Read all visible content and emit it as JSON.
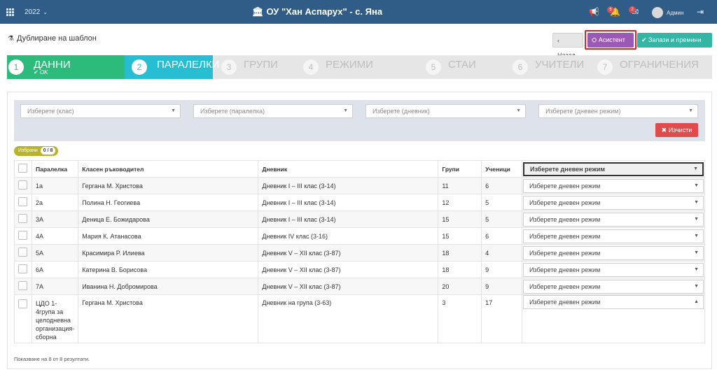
{
  "topbar": {
    "year": "2022",
    "school": "ОУ \"Хан Аспарух\" - с. Яна",
    "badge_notifications": "6",
    "badge_messages": "2",
    "user": "Админ"
  },
  "header": {
    "title": "Дублиране на шаблон",
    "back_label": "Назад",
    "assistant_label": "Асистент",
    "save_label": "Запази и премини"
  },
  "steps": [
    {
      "num": "1",
      "label": "ДАННИ",
      "sub": "OK"
    },
    {
      "num": "2",
      "label": "ПАРАЛЕЛКИ"
    },
    {
      "num": "3",
      "label": "ГРУПИ"
    },
    {
      "num": "4",
      "label": "РЕЖИМИ"
    },
    {
      "num": "5",
      "label": "СТАИ"
    },
    {
      "num": "6",
      "label": "УЧИТЕЛИ"
    },
    {
      "num": "7",
      "label": "ОГРАНИЧЕНИЯ"
    }
  ],
  "filters": {
    "class_placeholder": "Изберете (клас)",
    "section_placeholder": "Изберете (паралелка)",
    "journal_placeholder": "Изберете (дневник)",
    "mode_placeholder": "Изберете (дневен режим)",
    "clear_label": "Изчисти"
  },
  "selected": {
    "label": "Избрани",
    "count": "0 / 8"
  },
  "table": {
    "headers": {
      "section": "Паралелка",
      "teacher": "Класен ръководител",
      "journal": "Дневник",
      "groups": "Групи",
      "students": "Ученици",
      "mode": "Изберете дневен режим"
    },
    "rows": [
      {
        "section": "1а",
        "teacher": "Гергана М. Христова",
        "journal": "Дневник I – III клас (3-14)",
        "groups": "11",
        "students": "6",
        "mode": "Изберете дневен режим"
      },
      {
        "section": "2а",
        "teacher": "Полина Н. Геогиева",
        "journal": "Дневник I – III клас (3-14)",
        "groups": "12",
        "students": "5",
        "mode": "Изберете дневен режим"
      },
      {
        "section": "3А",
        "teacher": "Деница Е. Божидарова",
        "journal": "Дневник I – III клас (3-14)",
        "groups": "15",
        "students": "5",
        "mode": "Изберете дневен режим"
      },
      {
        "section": "4А",
        "teacher": "Мария К. Атанасова",
        "journal": "Дневник IV клас (3-16)",
        "groups": "15",
        "students": "6",
        "mode": "Изберете дневен режим"
      },
      {
        "section": "5А",
        "teacher": "Красимира Р. Илиева",
        "journal": "Дневник V – XII клас (3-87)",
        "groups": "18",
        "students": "4",
        "mode": "Изберете дневен режим"
      },
      {
        "section": "6А",
        "teacher": "Катерина В. Борисова",
        "journal": "Дневник V – XII клас (3-87)",
        "groups": "18",
        "students": "9",
        "mode": "Изберете дневен режим"
      },
      {
        "section": "7А",
        "teacher": "Иванина Н. Добромирова",
        "journal": "Дневник V – XII клас (3-87)",
        "groups": "20",
        "students": "9",
        "mode": "Изберете дневен режим"
      }
    ],
    "last_row": {
      "section": "ЦДО 1-4група за целодневна организация-сборна",
      "teacher": "Гергана М. Христова",
      "journal": "Дневник на група (3-63)",
      "groups": "3",
      "students": "17",
      "mode": "Изберете дневен режим"
    }
  },
  "footer": "Показване на 8 от 8 резултати.",
  "colors": {
    "topbar": "#2f5d87",
    "step_done": "#2dbb7b",
    "step_active": "#27bdd2",
    "assistant": "#9b59b6",
    "save": "#35b6a4",
    "clear": "#e04c4c",
    "highlight_outline": "#d9261c"
  }
}
